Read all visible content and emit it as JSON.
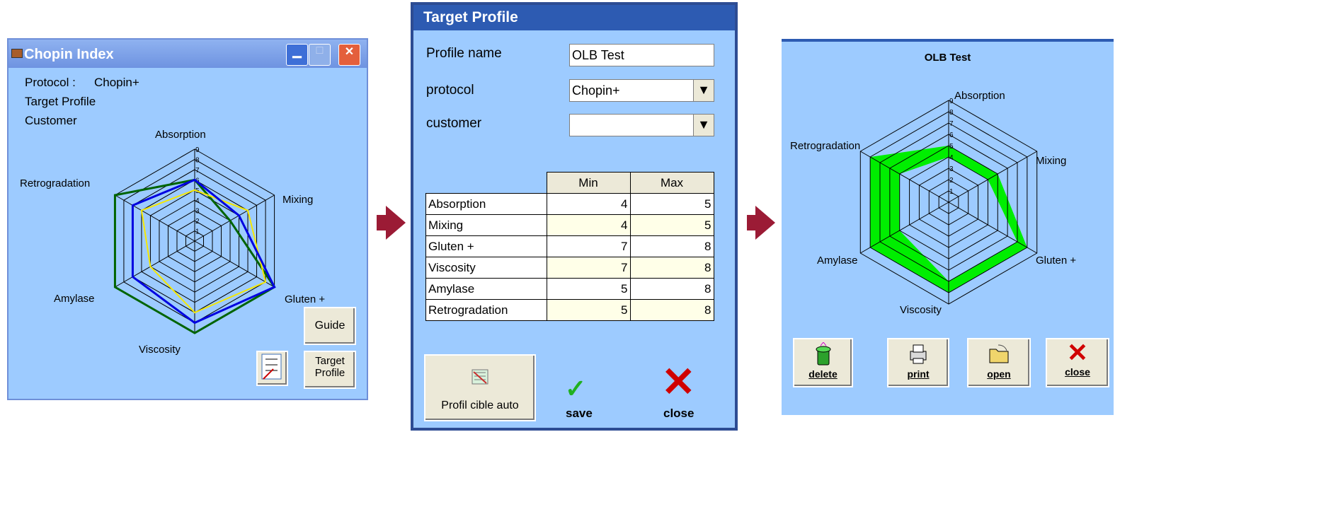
{
  "chopin": {
    "title": "Chopin Index",
    "protocol_label": "Protocol :",
    "protocol_value": "Chopin+",
    "target_profile": "Target Profile",
    "customer": "Customer",
    "labels": [
      "Absorption",
      "Mixing",
      "Gluten +",
      "Viscosity",
      "Amylase",
      "Retrogradation"
    ],
    "ticks": [
      "1",
      "2",
      "3",
      "4",
      "5",
      "6",
      "7",
      "8",
      "9"
    ],
    "guide": "Guide",
    "target_btn": [
      "Target",
      "Profile"
    ],
    "series": [
      {
        "name": "green",
        "values": [
          6,
          4,
          9,
          9,
          9,
          9
        ]
      },
      {
        "name": "yellow",
        "values": [
          5,
          6,
          8,
          7,
          5,
          6
        ]
      },
      {
        "name": "blue",
        "values": [
          6,
          5,
          9,
          8,
          7,
          7
        ]
      }
    ]
  },
  "target": {
    "title": "Target Profile",
    "profile_name_label": "Profile name",
    "profile_name_value": "OLB Test",
    "protocol_label": "protocol",
    "protocol_value": "Chopin+",
    "customer_label": "customer",
    "customer_value": "",
    "headers": [
      "Min",
      "Max"
    ],
    "rows": [
      {
        "name": "Absorption",
        "min": "4",
        "max": "5"
      },
      {
        "name": "Mixing",
        "min": "4",
        "max": "5"
      },
      {
        "name": "Gluten +",
        "min": "7",
        "max": "8"
      },
      {
        "name": "Viscosity",
        "min": "7",
        "max": "8"
      },
      {
        "name": "Amylase",
        "min": "5",
        "max": "8"
      },
      {
        "name": "Retrogradation",
        "min": "5",
        "max": "8"
      }
    ],
    "auto_label": "Profil cible auto",
    "save_label": "save",
    "close_label": "close"
  },
  "result": {
    "title": "OLB Test",
    "labels": [
      "Absorption",
      "Mixing",
      "Gluten +",
      "Viscosity",
      "Amylase",
      "Retrogradation"
    ],
    "ticks": [
      "1",
      "2",
      "3",
      "4",
      "5",
      "6",
      "7",
      "8",
      "9"
    ],
    "buttons": [
      "delete",
      "print",
      "open",
      "close"
    ],
    "min_values": [
      4,
      4,
      7,
      7,
      5,
      5
    ],
    "max_values": [
      5,
      5,
      8,
      8,
      8,
      8
    ]
  }
}
